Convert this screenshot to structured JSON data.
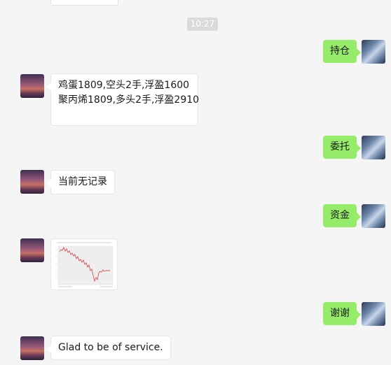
{
  "timestamp": "10:27",
  "messages": [
    {
      "side": "out",
      "text": "持仓"
    },
    {
      "side": "in",
      "lines": [
        "鸡蛋1809,空头2手,浮盈1600",
        "聚丙烯1809,多头2手,浮盈2910"
      ]
    },
    {
      "side": "out",
      "text": "委托"
    },
    {
      "side": "in",
      "lines": [
        "当前无记录"
      ]
    },
    {
      "side": "out",
      "text": "资金"
    },
    {
      "side": "in",
      "type": "image",
      "image_name": "equity-chart-thumbnail"
    },
    {
      "side": "out",
      "text": "谢谢"
    },
    {
      "side": "in",
      "lines": [
        "Glad to be of service."
      ]
    }
  ],
  "colors": {
    "background": "#f5f5f5",
    "outgoing_bubble": "#95ec69",
    "incoming_bubble": "#ffffff",
    "chart_line": "#d9534f"
  }
}
